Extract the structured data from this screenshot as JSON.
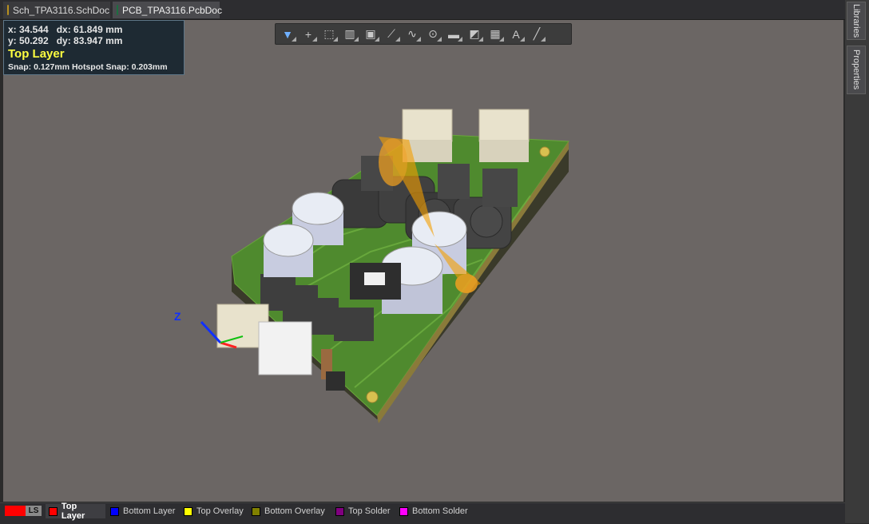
{
  "tabs": [
    {
      "label": "Sch_TPA3116.SchDoc",
      "icon": "schematic-doc-icon"
    },
    {
      "label": "PCB_TPA3116.PcbDoc",
      "icon": "pcb-doc-icon"
    }
  ],
  "coords": {
    "line1": "x: 34.544   dx: 61.849 mm",
    "line2": "y: 50.292   dy: 83.947 mm",
    "layer": "Top Layer",
    "snap": "Snap: 0.127mm Hotspot Snap: 0.203mm"
  },
  "toolbar": [
    "filter-icon",
    "add-icon",
    "select-rect-icon",
    "align-icon",
    "component-icon",
    "route-icon",
    "diff-pair-icon",
    "via-pin-icon",
    "fill-icon",
    "polygon-icon",
    "dimension-icon",
    "text-icon",
    "line-icon"
  ],
  "side_tabs": [
    "Libraries",
    "Properties"
  ],
  "layers": {
    "ls_label": "LS",
    "items": [
      {
        "label": "Top Layer",
        "color": "#ff0000",
        "active": true
      },
      {
        "label": "Bottom Layer",
        "color": "#0000ff",
        "active": false
      },
      {
        "label": "Top Overlay",
        "color": "#ffff00",
        "active": false
      },
      {
        "label": "Bottom Overlay",
        "color": "#808000",
        "active": false
      },
      {
        "label": "Top Solder",
        "color": "#800080",
        "active": false
      },
      {
        "label": "Bottom Solder",
        "color": "#ff00ff",
        "active": false
      }
    ]
  },
  "axes": {
    "z": "Z"
  },
  "colors": {
    "board": "#4f8a2e",
    "viewport": "#6b6664",
    "accent": "#ffff40"
  }
}
